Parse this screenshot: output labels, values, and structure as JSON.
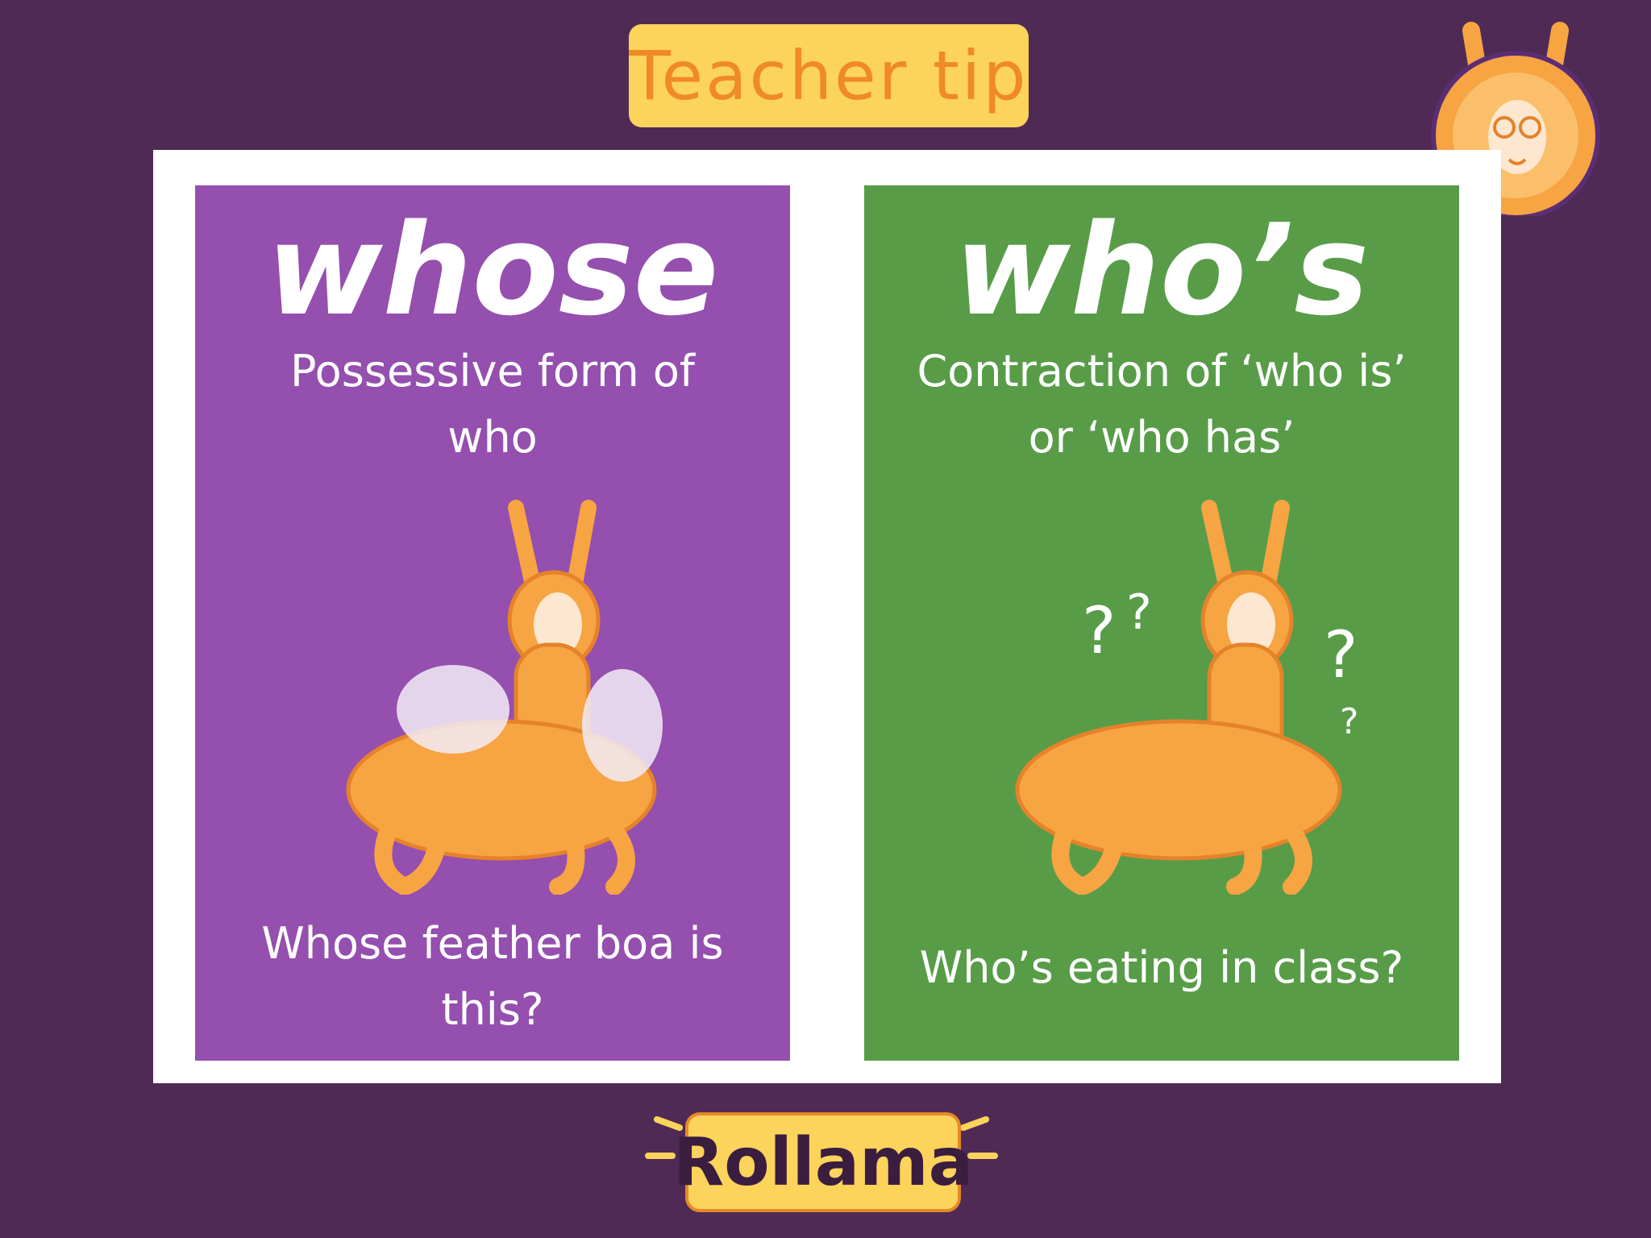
{
  "header": {
    "title": "Teacher tip"
  },
  "cards": [
    {
      "word": "whose",
      "definition_line1": "Possessive form of",
      "definition_line2": "who",
      "example_line1": "Whose feather boa is",
      "example_line2": "this?",
      "background": "#944faf"
    },
    {
      "word": "who’s",
      "definition_line1": "Contraction of ‘who is’",
      "definition_line2": "or ‘who has’",
      "example_line1": "Who’s eating in class?",
      "example_line2": "",
      "background": "#589c48"
    }
  ],
  "logo": {
    "text": "Rollama"
  },
  "colors": {
    "page_background": "#4f2a55",
    "badge_yellow": "#fcd35b",
    "badge_text": "#f08a24",
    "llama_orange": "#f7a443"
  }
}
